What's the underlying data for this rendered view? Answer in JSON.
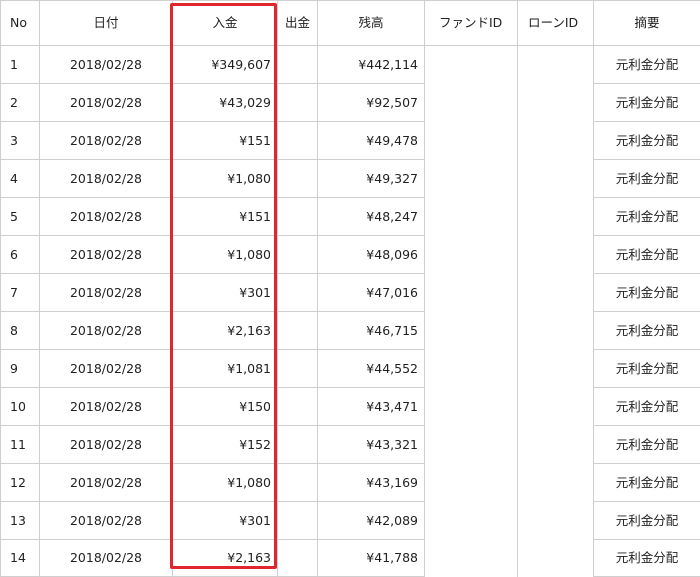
{
  "columns": {
    "no": "No",
    "date": "日付",
    "deposit": "入金",
    "withdrawal": "出金",
    "balance": "残高",
    "fund_id": "ファンドID",
    "loan_id": "ローンID",
    "memo": "摘要"
  },
  "rows": [
    {
      "no": "1",
      "date": "2018/02/28",
      "deposit": "¥349,607",
      "withdrawal": "",
      "balance": "¥442,114",
      "fund_id": "",
      "loan_id": "",
      "memo": "元利金分配"
    },
    {
      "no": "2",
      "date": "2018/02/28",
      "deposit": "¥43,029",
      "withdrawal": "",
      "balance": "¥92,507",
      "fund_id": "",
      "loan_id": "",
      "memo": "元利金分配"
    },
    {
      "no": "3",
      "date": "2018/02/28",
      "deposit": "¥151",
      "withdrawal": "",
      "balance": "¥49,478",
      "fund_id": "",
      "loan_id": "",
      "memo": "元利金分配"
    },
    {
      "no": "4",
      "date": "2018/02/28",
      "deposit": "¥1,080",
      "withdrawal": "",
      "balance": "¥49,327",
      "fund_id": "",
      "loan_id": "",
      "memo": "元利金分配"
    },
    {
      "no": "5",
      "date": "2018/02/28",
      "deposit": "¥151",
      "withdrawal": "",
      "balance": "¥48,247",
      "fund_id": "",
      "loan_id": "",
      "memo": "元利金分配"
    },
    {
      "no": "6",
      "date": "2018/02/28",
      "deposit": "¥1,080",
      "withdrawal": "",
      "balance": "¥48,096",
      "fund_id": "",
      "loan_id": "",
      "memo": "元利金分配"
    },
    {
      "no": "7",
      "date": "2018/02/28",
      "deposit": "¥301",
      "withdrawal": "",
      "balance": "¥47,016",
      "fund_id": "",
      "loan_id": "",
      "memo": "元利金分配"
    },
    {
      "no": "8",
      "date": "2018/02/28",
      "deposit": "¥2,163",
      "withdrawal": "",
      "balance": "¥46,715",
      "fund_id": "",
      "loan_id": "",
      "memo": "元利金分配"
    },
    {
      "no": "9",
      "date": "2018/02/28",
      "deposit": "¥1,081",
      "withdrawal": "",
      "balance": "¥44,552",
      "fund_id": "",
      "loan_id": "",
      "memo": "元利金分配"
    },
    {
      "no": "10",
      "date": "2018/02/28",
      "deposit": "¥150",
      "withdrawal": "",
      "balance": "¥43,471",
      "fund_id": "",
      "loan_id": "",
      "memo": "元利金分配"
    },
    {
      "no": "11",
      "date": "2018/02/28",
      "deposit": "¥152",
      "withdrawal": "",
      "balance": "¥43,321",
      "fund_id": "",
      "loan_id": "",
      "memo": "元利金分配"
    },
    {
      "no": "12",
      "date": "2018/02/28",
      "deposit": "¥1,080",
      "withdrawal": "",
      "balance": "¥43,169",
      "fund_id": "",
      "loan_id": "",
      "memo": "元利金分配"
    },
    {
      "no": "13",
      "date": "2018/02/28",
      "deposit": "¥301",
      "withdrawal": "",
      "balance": "¥42,089",
      "fund_id": "",
      "loan_id": "",
      "memo": "元利金分配"
    },
    {
      "no": "14",
      "date": "2018/02/28",
      "deposit": "¥2,163",
      "withdrawal": "",
      "balance": "¥41,788",
      "fund_id": "",
      "loan_id": "",
      "memo": "元利金分配"
    }
  ],
  "colors": {
    "highlight": "#e0262e",
    "grid": "#cfcfcf",
    "text": "#222222"
  }
}
